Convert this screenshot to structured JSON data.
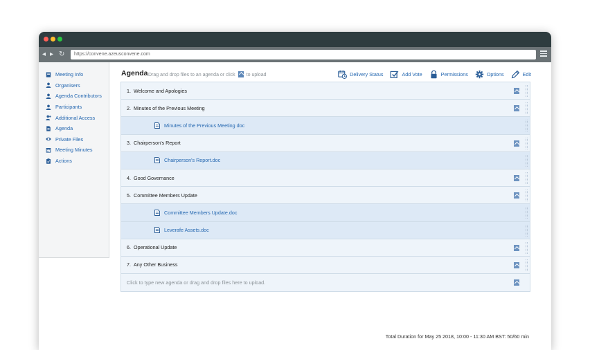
{
  "browser": {
    "url": "https://convene.azeusconvene.com",
    "nav_back": "◂",
    "nav_forward": "▸",
    "nav_reload": "↻"
  },
  "sidebar": {
    "items": [
      {
        "label": "Meeting Info",
        "icon": "book-icon"
      },
      {
        "label": "Organisers",
        "icon": "person-icon"
      },
      {
        "label": "Agenda Contributors",
        "icon": "person-icon"
      },
      {
        "label": "Participants",
        "icon": "person-icon"
      },
      {
        "label": "Additional Access",
        "icon": "person-add-icon"
      },
      {
        "label": "Agenda",
        "icon": "document-icon"
      },
      {
        "label": "Private Files",
        "icon": "eye-icon"
      },
      {
        "label": "Meeting Minutes",
        "icon": "calendar-icon"
      },
      {
        "label": "Actions",
        "icon": "clipboard-icon"
      }
    ]
  },
  "header": {
    "title": "Agenda",
    "hint_before": "Drag and drop files to an agenda or click",
    "hint_after": "to upload"
  },
  "toolbar": {
    "delivery_status": "Delivery Status",
    "add_vote": "Add Vote",
    "permissions": "Permissions",
    "options": "Options",
    "edit": "Edit"
  },
  "agenda": {
    "rows": [
      {
        "type": "item",
        "num": "1.",
        "title": "Welcome and Apologies"
      },
      {
        "type": "item",
        "num": "2.",
        "title": "Minutes of the Previous Meeting"
      },
      {
        "type": "file",
        "title": "Minutes of the Previous Meeting doc"
      },
      {
        "type": "item",
        "num": "3.",
        "title": "Chairperson's Report"
      },
      {
        "type": "file",
        "title": "Chairperson's Report.doc"
      },
      {
        "type": "item",
        "num": "4.",
        "title": "Good Governance"
      },
      {
        "type": "item",
        "num": "5.",
        "title": "Committee Members Update"
      },
      {
        "type": "file",
        "title": "Committee Members Update.doc"
      },
      {
        "type": "file",
        "title": "Leverafe Assets.doc"
      },
      {
        "type": "item",
        "num": "6.",
        "title": "Operational Update"
      },
      {
        "type": "item",
        "num": "7.",
        "title": "Any Other Business"
      }
    ],
    "new_placeholder": "Click to type new agenda or drag and drop files here to upload."
  },
  "footer": {
    "duration": "Total Duration for May 25 2018, 10:00 - 11:30 AM BST:   50/60 min"
  },
  "colors": {
    "link": "#2467b0",
    "item_bg": "#eef4fa",
    "file_bg": "#dde9f6",
    "titlebar": "#2e3c3f"
  }
}
